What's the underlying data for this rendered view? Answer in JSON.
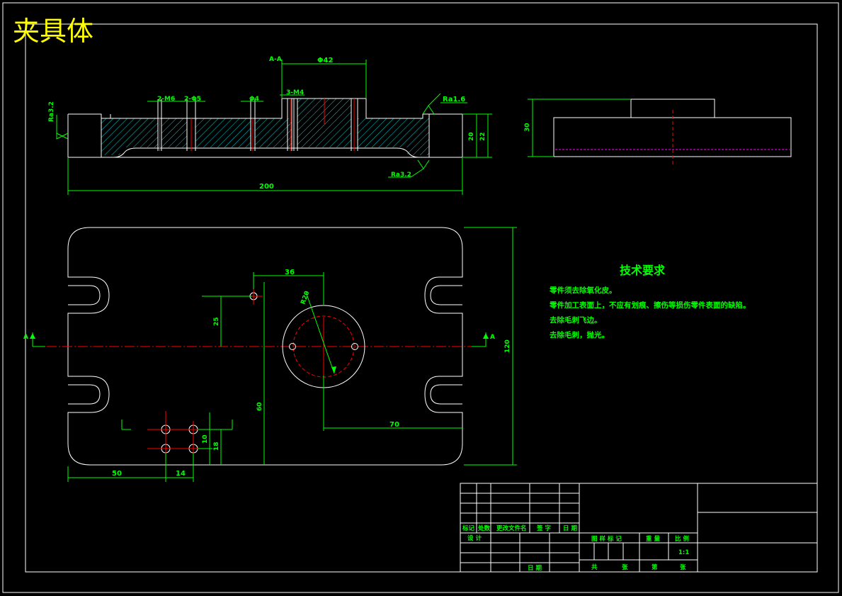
{
  "drawing_title": "夹具体",
  "section_label": "A-A",
  "dimensions": {
    "bore_dia": "Φ42",
    "thread_left": "2-M6",
    "holes_left": "2-Φ5",
    "hole_single": "Φ4",
    "thread_right": "3-M4",
    "length_overall": "200",
    "height_20": "20",
    "height_22": "22",
    "height_30": "30",
    "dim_36": "36",
    "circle_r": "R20",
    "dim_25": "25",
    "dim_60": "60",
    "dim_70": "70",
    "dim_120": "120",
    "dim_50": "50",
    "dim_14": "14",
    "dim_10": "10",
    "dim_18": "18"
  },
  "roughness": {
    "left": "Ra3.2",
    "top_right": "Ra1.6",
    "bottom": "Ra3.2"
  },
  "view_markers": {
    "left": "A",
    "right": "A"
  },
  "tech_requirements": {
    "heading": "技术要求",
    "items": [
      "零件须去除氧化皮。",
      "零件加工表面上，不应有划痕、擦伤等损伤零件表面的缺陷。",
      "去除毛刺飞边。",
      "去除毛刺，抛光。"
    ]
  },
  "title_block": {
    "col_mark": "标记",
    "col_count": "处数",
    "col_doc": "更改文件名",
    "col_sign": "签 字",
    "col_date": "日 期",
    "design": "设 计",
    "approve": "日 期",
    "stage": "图 样 标 记",
    "weight": "重 量",
    "scale_label": "比 例",
    "scale_value": "1:1",
    "sheets_total": "共",
    "sheet_label": "张",
    "sheet_num": "第",
    "sheet_label2": "张"
  }
}
